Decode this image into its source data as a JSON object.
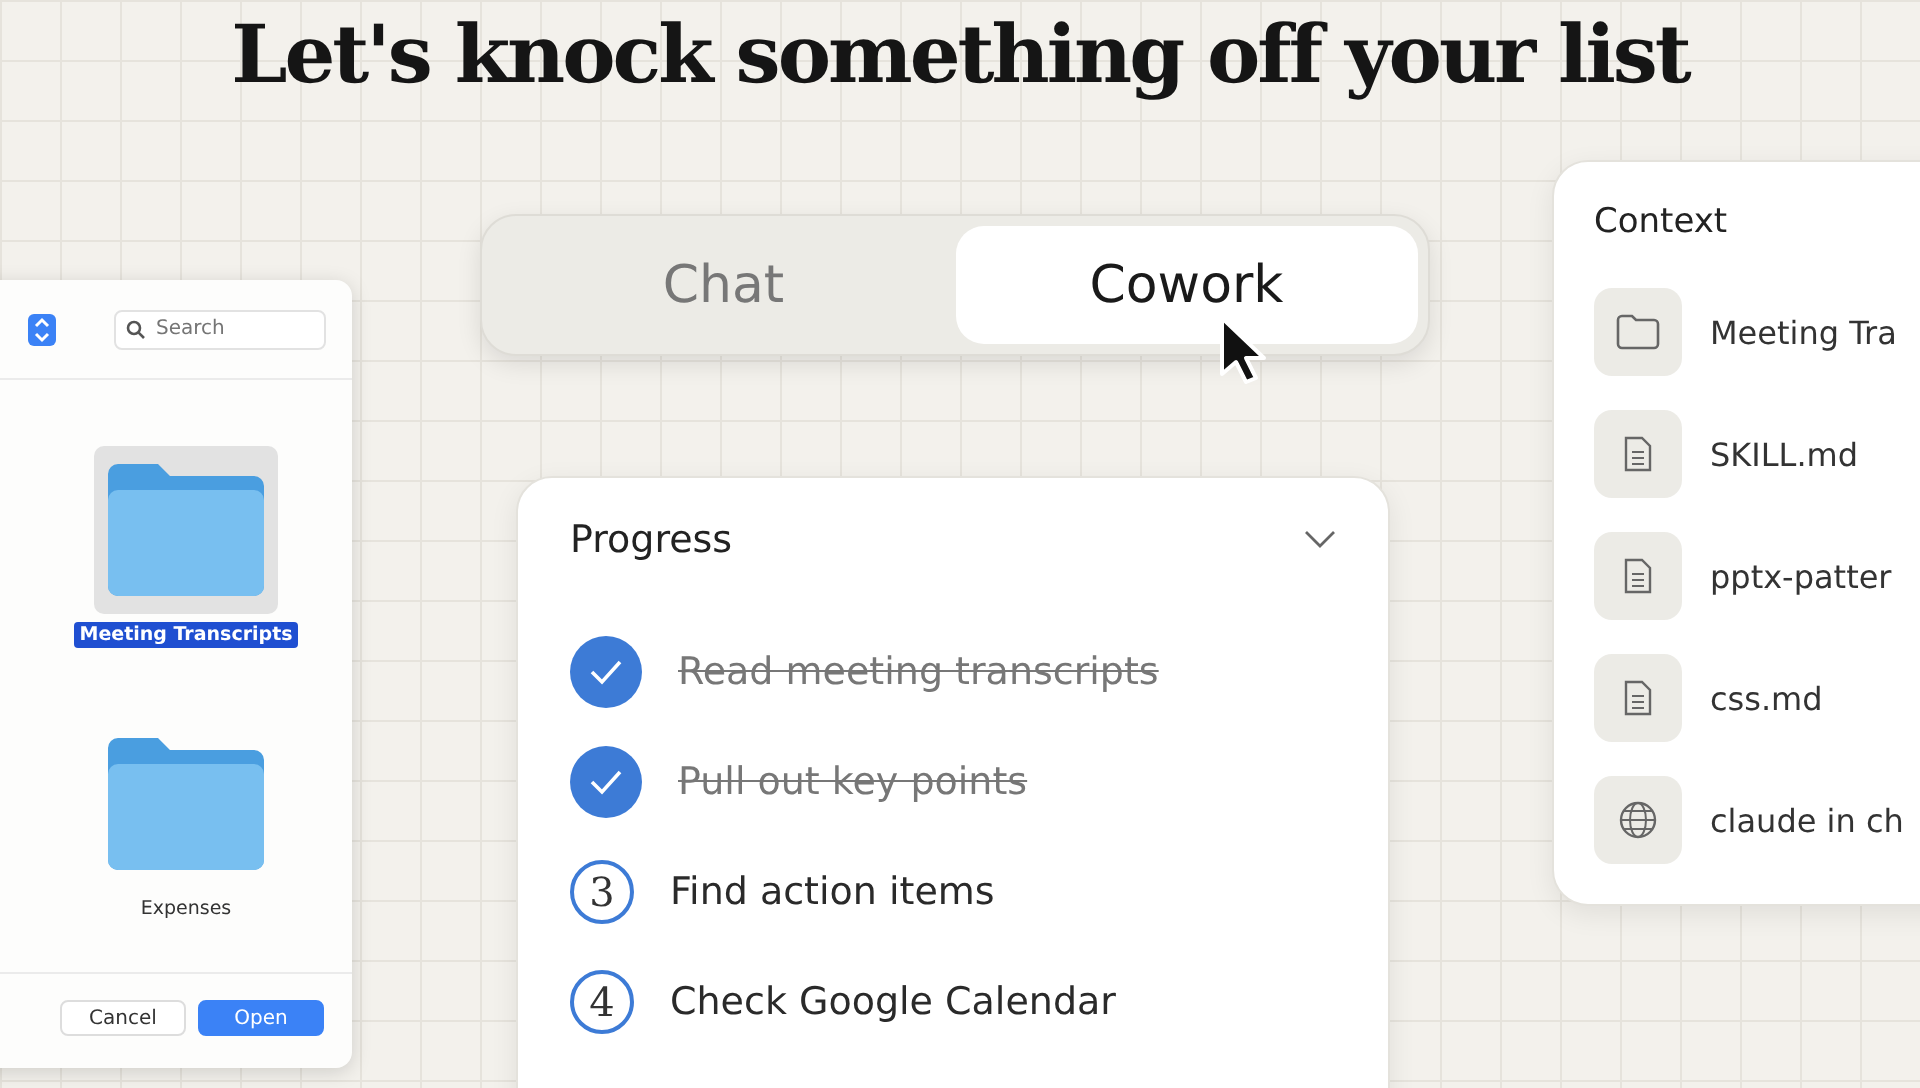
{
  "headline": "Let's knock something off your list",
  "file_dialog": {
    "search": {
      "placeholder": "Search"
    },
    "items": [
      {
        "label": "Meeting Transcripts",
        "selected": true
      },
      {
        "label": "Expenses",
        "selected": false
      }
    ],
    "buttons": [
      {
        "label": "Cancel",
        "kind": "secondary"
      },
      {
        "label": "Open",
        "kind": "primary"
      }
    ]
  },
  "mode_toggle": {
    "tabs": [
      {
        "label": "Chat",
        "selected": false
      },
      {
        "label": "Cowork",
        "selected": true
      }
    ]
  },
  "progress": {
    "title": "Progress",
    "expanded": true,
    "steps": [
      {
        "label": "Read meeting transcripts",
        "done": true
      },
      {
        "label": "Pull out key points",
        "done": true
      },
      {
        "label": "Find action items",
        "done": false,
        "number": "3"
      },
      {
        "label": "Check Google Calendar",
        "done": false,
        "number": "4"
      }
    ]
  },
  "context": {
    "title": "Context",
    "items": [
      {
        "label": "Meeting Tra",
        "kind": "folder"
      },
      {
        "label": "SKILL.md",
        "kind": "file"
      },
      {
        "label": "pptx-patter",
        "kind": "file"
      },
      {
        "label": "css.md",
        "kind": "file"
      },
      {
        "label": "claude in ch",
        "kind": "web"
      }
    ]
  }
}
